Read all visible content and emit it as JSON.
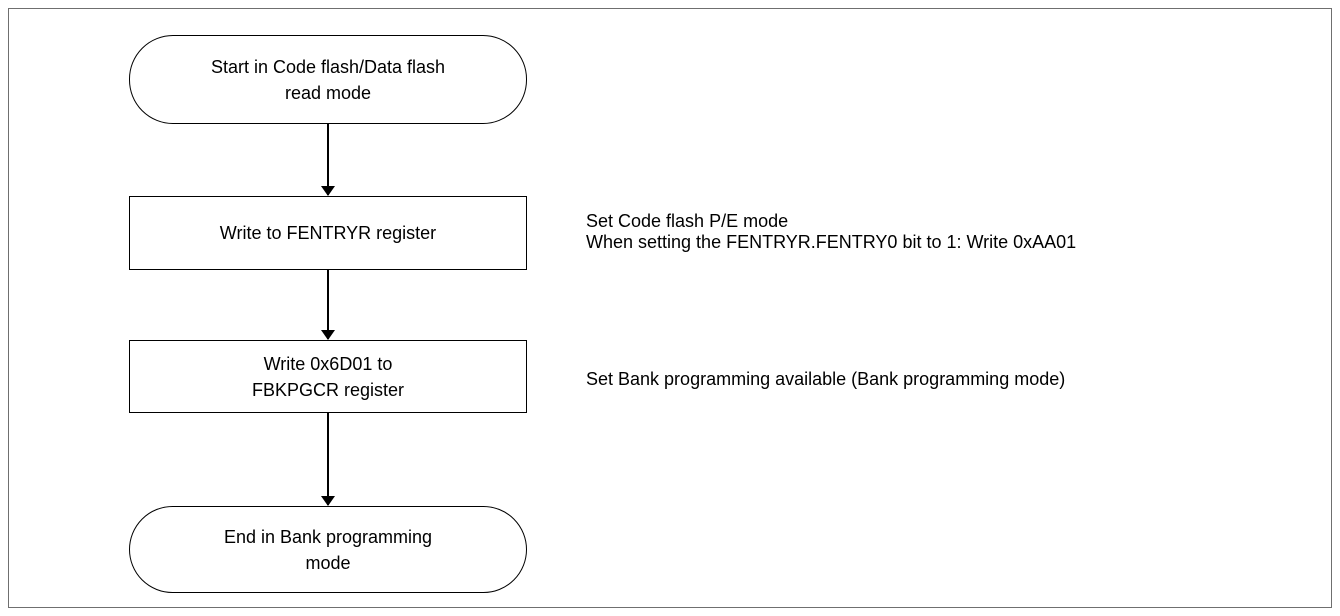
{
  "flowchart": {
    "start": {
      "label": "Start in Code flash/Data flash\nread mode"
    },
    "steps": [
      {
        "label": "Write to FENTRYR register",
        "note_lines": [
          "Set Code flash P/E mode",
          "When setting the FENTRYR.FENTRY0 bit to 1: Write 0xAA01"
        ]
      },
      {
        "label": "Write 0x6D01 to\nFBKPGCR register",
        "note_lines": [
          "Set Bank programming available (Bank programming mode)"
        ]
      }
    ],
    "end": {
      "label": "End in Bank programming\nmode"
    }
  },
  "colors": {
    "stroke": "#000000",
    "frame": "#6f6f6f",
    "background": "#ffffff"
  }
}
